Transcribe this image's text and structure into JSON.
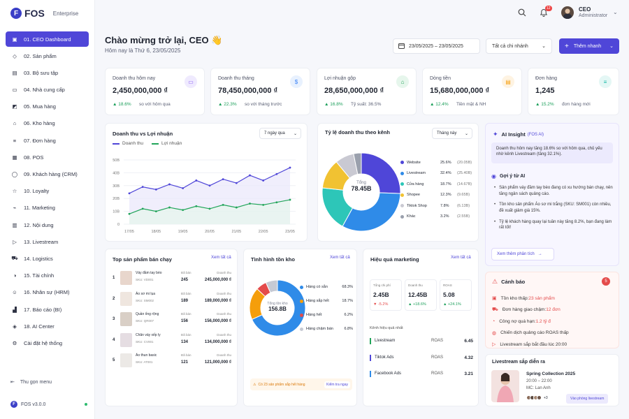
{
  "brand": {
    "name": "FOS",
    "edition": "Enterprise",
    "version": "FOS v3.0.0"
  },
  "nav": [
    "01. CEO Dashboard",
    "02. Sản phẩm",
    "03. Bộ sưu tập",
    "04. Nhà cung cấp",
    "05. Mua hàng",
    "06. Kho hàng",
    "07. Đơn hàng",
    "08. POS",
    "09. Khách hàng (CRM)",
    "10. Loyalty",
    "11. Marketing",
    "12. Nội dung",
    "13. Livestream",
    "14. Logistics",
    "15. Tài chính",
    "16. Nhân sự (HRM)",
    "17. Báo cáo (BI)",
    "18. AI Center",
    "Cài đặt hệ thống"
  ],
  "collapse_label": "Thu gọn menu",
  "user": {
    "name": "CEO",
    "role": "Administrator",
    "notifications": "12"
  },
  "header": {
    "greeting": "Chào mừng trở lại, CEO 👋",
    "date_line": "Hôm nay là Thứ 6, 23/05/2025",
    "date_range": "23/05/2025 – 23/05/2025",
    "branch": "Tất cả chi nhánh",
    "add": "Thêm nhanh"
  },
  "kpis": [
    {
      "title": "Doanh thu hôm nay",
      "value": "2,450,000,000 ₫",
      "change": "18.6%",
      "compare": "so với hôm qua",
      "color": "#8b5cf6",
      "bg": "#efeafe"
    },
    {
      "title": "Doanh thu tháng",
      "value": "78,450,000,000 ₫",
      "change": "22.3%",
      "compare": "so với tháng trước",
      "color": "#3b82f6",
      "bg": "#e8f1fe"
    },
    {
      "title": "Lợi nhuận gộp",
      "value": "28,650,000,000 ₫",
      "change": "16.8%",
      "compare": "Tỷ suất: 36.5%",
      "color": "#22a55a",
      "bg": "#e6f6ec"
    },
    {
      "title": "Dòng tiền",
      "value": "15,680,000,000 ₫",
      "change": "12.4%",
      "compare": "Tiền mặt & NH",
      "color": "#f59e0b",
      "bg": "#fef3e2"
    },
    {
      "title": "Đơn hàng",
      "value": "1,245",
      "change": "15.2%",
      "compare": "đơn hàng mới",
      "color": "#14b8a6",
      "bg": "#e4f7f5"
    }
  ],
  "revenue_chart": {
    "title": "Doanh thu vs Lợi nhuận",
    "range": "7 ngày qua",
    "legend": [
      "Doanh thu",
      "Lợi nhuận"
    ],
    "ylabels": [
      "50B",
      "40B",
      "30B",
      "20B",
      "10B",
      "0"
    ],
    "xlabels": [
      "17/05",
      "18/05",
      "19/05",
      "20/05",
      "21/05",
      "22/05",
      "23/05"
    ]
  },
  "chart_data": {
    "type": "line",
    "x": [
      "17/05",
      "17/05b",
      "18/05",
      "18/05b",
      "19/05",
      "19/05b",
      "20/05",
      "20/05b",
      "21/05",
      "21/05b",
      "22/05",
      "22/05b",
      "23/05"
    ],
    "series": [
      {
        "name": "Doanh thu",
        "values": [
          24,
          29,
          27,
          31,
          28,
          34,
          30,
          35,
          32,
          38,
          34,
          39,
          44
        ]
      },
      {
        "name": "Lợi nhuận",
        "values": [
          8,
          12,
          10,
          13,
          11,
          14,
          12,
          15,
          13,
          16,
          15,
          17,
          19
        ]
      }
    ],
    "ylim": [
      0,
      50
    ]
  },
  "channels": {
    "title": "Tỷ lệ doanh thu theo kênh",
    "range": "Tháng này",
    "center_label": "Tổng",
    "center_value": "78.45B",
    "items": [
      {
        "name": "Website",
        "pct": "25.6%",
        "amt": "(20.05B)",
        "color": "#4f46d8",
        "v": 25.6
      },
      {
        "name": "Livestream",
        "pct": "32.4%",
        "amt": "(25.40B)",
        "color": "#2f8be8",
        "v": 32.4
      },
      {
        "name": "Cửa hàng",
        "pct": "18.7%",
        "amt": "(14.67B)",
        "color": "#2dc6b8",
        "v": 18.7
      },
      {
        "name": "Shopee",
        "pct": "12.3%",
        "amt": "(9.65B)",
        "color": "#f1c232",
        "v": 12.3
      },
      {
        "name": "Tiktok Shop",
        "pct": "7.8%",
        "amt": "(6.13B)",
        "color": "#c9c9d2",
        "v": 7.8
      },
      {
        "name": "Khác",
        "pct": "3.2%",
        "amt": "(2.55B)",
        "color": "#9aa0ad",
        "v": 3.2
      }
    ]
  },
  "ai": {
    "title": "AI Insight",
    "tag": "(FOS AI)",
    "summary": "Doanh thu hôm nay tăng 18.6% so với hôm qua, chủ yếu nhờ kênh Livestream (tăng 32.1%).",
    "suggest_title": "Gợi ý từ AI",
    "suggestions": [
      "Sản phẩm váy đầm tay bèo đang có xu hướng bán chạy, nên tăng ngân sách quảng cáo.",
      "Tồn kho sản phẩm Áo sơ mi trắng (SKU: SM001) còn nhiều, đề xuất giảm giá 15%.",
      "Tỷ lệ khách hàng quay lại tuần này tăng 8.2%, bạn đang làm rất tốt!"
    ],
    "more": "Xem thêm phân tích"
  },
  "top": {
    "title": "Top sản phẩm bán chạy",
    "link": "Xem tất cả",
    "sold_label": "Đã bán",
    "rev_label": "Doanh thu",
    "items": [
      {
        "name": "Váy đầm tay bèo",
        "sku": "SKU: VD001",
        "sold": "245",
        "rev": "245,000,000 ₫"
      },
      {
        "name": "Áo sơ mi lụa",
        "sku": "SKU: SM002",
        "sold": "189",
        "rev": "189,000,000 ₫"
      },
      {
        "name": "Quần ống rộng",
        "sku": "SKU: QR007",
        "sold": "156",
        "rev": "156,000,000 ₫"
      },
      {
        "name": "Chân váy xếp ly",
        "sku": "SKU: CV001",
        "sold": "134",
        "rev": "134,000,000 ₫"
      },
      {
        "name": "Áo thun basic",
        "sku": "SKU: AT001",
        "sold": "121",
        "rev": "121,000,000 ₫"
      }
    ]
  },
  "stock": {
    "title": "Tình hình tồn kho",
    "link": "Xem tất cả",
    "center_label": "Tổng tồn kho",
    "center_value": "156.8B",
    "items": [
      {
        "name": "Hàng có sẵn",
        "pct": "68.3%",
        "color": "#2f8be8",
        "v": 68.3
      },
      {
        "name": "Hàng sắp hết",
        "pct": "18.7%",
        "color": "#f59e0b",
        "v": 18.7
      },
      {
        "name": "Hàng hết",
        "pct": "6.2%",
        "color": "#e44b4b",
        "v": 6.2
      },
      {
        "name": "Hàng chậm bán",
        "pct": "6.8%",
        "color": "#c6cad4",
        "v": 6.8
      }
    ],
    "warning": "Có 23 sản phẩm sắp hết hàng",
    "check": "Kiểm tra ngay"
  },
  "mkt": {
    "title": "Hiệu quả marketing",
    "link": "Xem tất cả",
    "stats": [
      {
        "label": "Tổng chi phí",
        "value": "2.45B",
        "chg": "▼ -5.2%",
        "color": "#e44b4b"
      },
      {
        "label": "Doanh thu",
        "value": "12.45B",
        "chg": "▲ +18.6%",
        "color": "#1a9e59"
      },
      {
        "label": "ROAS",
        "value": "5.08",
        "chg": "▲ +24.1%",
        "color": "#1a9e59"
      }
    ],
    "best": "Kênh hiệu quả nhất",
    "channels": [
      {
        "name": "Livestream",
        "metric": "ROAS",
        "val": "6.45",
        "color": "#22a55a"
      },
      {
        "name": "Tiktok Ads",
        "metric": "ROAS",
        "val": "4.32",
        "color": "#4f46d8"
      },
      {
        "name": "Facebook Ads",
        "metric": "ROAS",
        "val": "3.21",
        "color": "#2f8be8"
      }
    ]
  },
  "alerts": {
    "title": "Cảnh báo",
    "count": "5",
    "items": [
      {
        "pre": "Tồn kho thấp: ",
        "hl": "23 sản phẩm"
      },
      {
        "pre": "Đơn hàng giao chậm: ",
        "hl": "12 đơn"
      },
      {
        "pre": "Công nợ quá hạn: ",
        "hl": "1.2 tỷ đ"
      },
      {
        "pre": "Chiến dịch quảng cáo ROAS thấp",
        "hl": ""
      },
      {
        "pre": "Livestream sắp bắt đầu lúc 20:00",
        "hl": ""
      }
    ]
  },
  "live": {
    "title": "Livestream sắp diễn ra",
    "name": "Spring Collection 2025",
    "time": "20:00 – 22:00",
    "mc": "MC: Lan Anh",
    "more": "+3",
    "join": "Vào phòng livestream"
  }
}
